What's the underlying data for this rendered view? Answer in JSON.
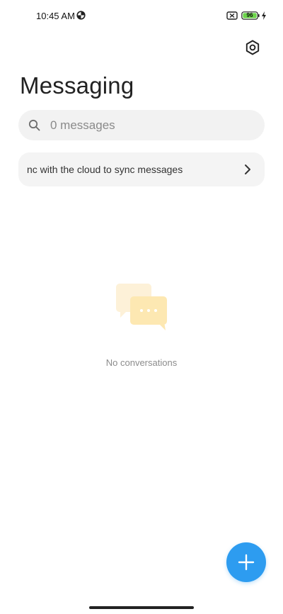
{
  "status_bar": {
    "time": "10:45 AM",
    "battery_level": "96",
    "icons": [
      "data-saver-icon",
      "no-sim-icon",
      "battery-icon",
      "charging-icon"
    ]
  },
  "header": {
    "title": "Messaging",
    "settings_icon": "gear-icon"
  },
  "search": {
    "placeholder": "0 messages",
    "icon": "search-icon"
  },
  "sync_banner": {
    "text": "nc with the cloud to sync messages",
    "icon": "chevron-right-icon"
  },
  "empty_state": {
    "icon": "chat-bubbles-icon",
    "text": "No conversations"
  },
  "fab": {
    "icon": "plus-icon",
    "color": "#2d9cf0"
  },
  "colors": {
    "accent": "#2d9cf0",
    "battery": "#6cd54a",
    "illustration": "#fde8b2"
  }
}
